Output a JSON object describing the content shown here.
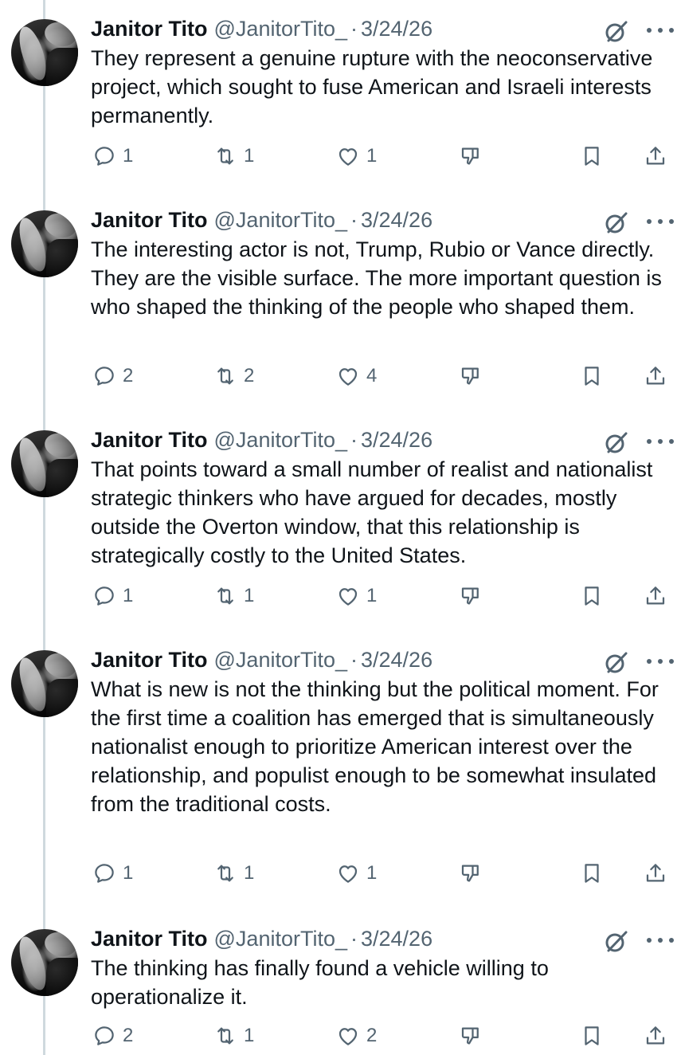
{
  "author": {
    "name": "Janitor Tito",
    "handle": "@JanitorTito_",
    "separator": "·"
  },
  "tweets": [
    {
      "date": "3/24/26",
      "text": "They represent a genuine rupture with the neoconservative project, which sought to fuse American and Israeli interests permanently.",
      "replies": "1",
      "retweets": "1",
      "likes": "1"
    },
    {
      "date": "3/24/26",
      "text": "The interesting actor is not, Trump, Rubio or Vance directly. They are the visible surface. The more important question is who shaped the thinking of the people who shaped them.",
      "replies": "2",
      "retweets": "2",
      "likes": "4"
    },
    {
      "date": "3/24/26",
      "text": "That points toward a small number of realist and nationalist strategic thinkers who have argued for decades, mostly outside the Overton window, that this relationship is strategically costly to the United States.",
      "replies": "1",
      "retweets": "1",
      "likes": "1"
    },
    {
      "date": "3/24/26",
      "text": "What is new is not the thinking but the political moment. For the first time a coalition has emerged that is simultaneously nationalist enough to prioritize American interest over the relationship, and populist enough to be somewhat insulated from the traditional costs.",
      "replies": "1",
      "retweets": "1",
      "likes": "1"
    },
    {
      "date": "3/24/26",
      "text": "The thinking has finally found a vehicle willing to operationalize it.",
      "replies": "2",
      "retweets": "1",
      "likes": "2"
    }
  ],
  "icons": {
    "grok": "grok-icon",
    "more": "more-icon",
    "reply": "reply-icon",
    "retweet": "retweet-icon",
    "like": "heart-icon",
    "dislike": "dislike-icon",
    "bookmark": "bookmark-icon",
    "share": "share-icon"
  },
  "colors": {
    "text": "#0f1419",
    "secondary": "#536471",
    "thread_line": "#cfd9de"
  }
}
